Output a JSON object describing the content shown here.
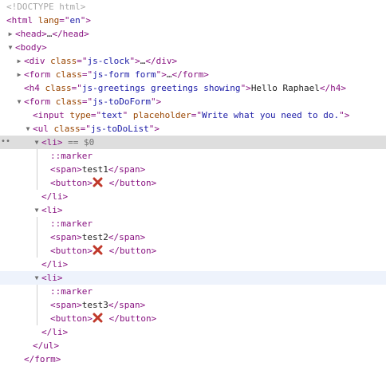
{
  "tree": [
    {
      "indent": 0,
      "toggle": "none",
      "selected": false,
      "hovered": false,
      "parts": [
        {
          "t": "doctype",
          "v": "<!DOCTYPE html>"
        }
      ]
    },
    {
      "indent": 0,
      "toggle": "none",
      "selected": false,
      "hovered": false,
      "parts": [
        {
          "t": "tag",
          "v": "<html "
        },
        {
          "t": "attr",
          "v": "lang"
        },
        {
          "t": "tag",
          "v": "=\""
        },
        {
          "t": "val",
          "v": "en"
        },
        {
          "t": "tag",
          "v": "\">"
        }
      ]
    },
    {
      "indent": 1,
      "toggle": "collapsed",
      "selected": false,
      "hovered": false,
      "parts": [
        {
          "t": "tag",
          "v": "<head>"
        },
        {
          "t": "txt",
          "v": "…"
        },
        {
          "t": "tag",
          "v": "</head>"
        }
      ]
    },
    {
      "indent": 1,
      "toggle": "expanded",
      "selected": false,
      "hovered": false,
      "parts": [
        {
          "t": "tag",
          "v": "<body>"
        }
      ]
    },
    {
      "indent": 2,
      "toggle": "collapsed",
      "selected": false,
      "hovered": false,
      "parts": [
        {
          "t": "tag",
          "v": "<div "
        },
        {
          "t": "attr",
          "v": "class"
        },
        {
          "t": "tag",
          "v": "=\""
        },
        {
          "t": "val",
          "v": "js-clock"
        },
        {
          "t": "tag",
          "v": "\">"
        },
        {
          "t": "txt",
          "v": "…"
        },
        {
          "t": "tag",
          "v": "</div>"
        }
      ]
    },
    {
      "indent": 2,
      "toggle": "collapsed",
      "selected": false,
      "hovered": false,
      "parts": [
        {
          "t": "tag",
          "v": "<form "
        },
        {
          "t": "attr",
          "v": "class"
        },
        {
          "t": "tag",
          "v": "=\""
        },
        {
          "t": "val",
          "v": "js-form form"
        },
        {
          "t": "tag",
          "v": "\">"
        },
        {
          "t": "txt",
          "v": "…"
        },
        {
          "t": "tag",
          "v": "</form>"
        }
      ]
    },
    {
      "indent": 2,
      "toggle": "none",
      "selected": false,
      "hovered": false,
      "parts": [
        {
          "t": "tag",
          "v": "<h4 "
        },
        {
          "t": "attr",
          "v": "class"
        },
        {
          "t": "tag",
          "v": "=\""
        },
        {
          "t": "val",
          "v": "js-greetings greetings showing"
        },
        {
          "t": "tag",
          "v": "\">"
        },
        {
          "t": "txt",
          "v": "Hello Raphael"
        },
        {
          "t": "tag",
          "v": "</h4>"
        }
      ]
    },
    {
      "indent": 2,
      "toggle": "expanded",
      "selected": false,
      "hovered": false,
      "parts": [
        {
          "t": "tag",
          "v": "<form "
        },
        {
          "t": "attr",
          "v": "class"
        },
        {
          "t": "tag",
          "v": "=\""
        },
        {
          "t": "val",
          "v": "js-toDoForm"
        },
        {
          "t": "tag",
          "v": "\">"
        }
      ]
    },
    {
      "indent": 3,
      "toggle": "none",
      "selected": false,
      "hovered": false,
      "parts": [
        {
          "t": "tag",
          "v": "<input "
        },
        {
          "t": "attr",
          "v": "type"
        },
        {
          "t": "tag",
          "v": "=\""
        },
        {
          "t": "val",
          "v": "text"
        },
        {
          "t": "tag",
          "v": "\" "
        },
        {
          "t": "attr",
          "v": "placeholder"
        },
        {
          "t": "tag",
          "v": "=\""
        },
        {
          "t": "val",
          "v": "Write what you need to do."
        },
        {
          "t": "tag",
          "v": "\">"
        }
      ]
    },
    {
      "indent": 3,
      "toggle": "expanded",
      "selected": false,
      "hovered": false,
      "parts": [
        {
          "t": "tag",
          "v": "<ul "
        },
        {
          "t": "attr",
          "v": "class"
        },
        {
          "t": "tag",
          "v": "=\""
        },
        {
          "t": "val",
          "v": "js-toDoList"
        },
        {
          "t": "tag",
          "v": "\">"
        }
      ]
    },
    {
      "indent": 4,
      "toggle": "expanded",
      "selected": true,
      "hovered": false,
      "dots": "••",
      "parts": [
        {
          "t": "tag",
          "v": "<li>"
        },
        {
          "t": "eq",
          "v": " == $0"
        }
      ]
    },
    {
      "indent": 5,
      "toggle": "none",
      "selected": false,
      "hovered": false,
      "guide": true,
      "parts": [
        {
          "t": "pseudo",
          "v": "::marker"
        }
      ]
    },
    {
      "indent": 5,
      "toggle": "none",
      "selected": false,
      "hovered": false,
      "guide": true,
      "parts": [
        {
          "t": "tag",
          "v": "<span>"
        },
        {
          "t": "txt",
          "v": "test1"
        },
        {
          "t": "tag",
          "v": "</span>"
        }
      ]
    },
    {
      "indent": 5,
      "toggle": "none",
      "selected": false,
      "hovered": false,
      "guide": true,
      "parts": [
        {
          "t": "tag",
          "v": "<button>"
        },
        {
          "t": "icon",
          "v": "cross-mark-icon"
        },
        {
          "t": "txt",
          "v": " "
        },
        {
          "t": "tag",
          "v": "</button>"
        }
      ]
    },
    {
      "indent": 4,
      "toggle": "none",
      "selected": false,
      "hovered": false,
      "parts": [
        {
          "t": "tag",
          "v": "</li>"
        }
      ]
    },
    {
      "indent": 4,
      "toggle": "expanded",
      "selected": false,
      "hovered": false,
      "parts": [
        {
          "t": "tag",
          "v": "<li>"
        }
      ]
    },
    {
      "indent": 5,
      "toggle": "none",
      "selected": false,
      "hovered": false,
      "guide": true,
      "parts": [
        {
          "t": "pseudo",
          "v": "::marker"
        }
      ]
    },
    {
      "indent": 5,
      "toggle": "none",
      "selected": false,
      "hovered": false,
      "guide": true,
      "parts": [
        {
          "t": "tag",
          "v": "<span>"
        },
        {
          "t": "txt",
          "v": "test2"
        },
        {
          "t": "tag",
          "v": "</span>"
        }
      ]
    },
    {
      "indent": 5,
      "toggle": "none",
      "selected": false,
      "hovered": false,
      "guide": true,
      "parts": [
        {
          "t": "tag",
          "v": "<button>"
        },
        {
          "t": "icon",
          "v": "cross-mark-icon"
        },
        {
          "t": "txt",
          "v": " "
        },
        {
          "t": "tag",
          "v": "</button>"
        }
      ]
    },
    {
      "indent": 4,
      "toggle": "none",
      "selected": false,
      "hovered": false,
      "parts": [
        {
          "t": "tag",
          "v": "</li>"
        }
      ]
    },
    {
      "indent": 4,
      "toggle": "expanded",
      "selected": false,
      "hovered": true,
      "parts": [
        {
          "t": "tag",
          "v": "<li>"
        }
      ]
    },
    {
      "indent": 5,
      "toggle": "none",
      "selected": false,
      "hovered": false,
      "guide": true,
      "parts": [
        {
          "t": "pseudo",
          "v": "::marker"
        }
      ]
    },
    {
      "indent": 5,
      "toggle": "none",
      "selected": false,
      "hovered": false,
      "guide": true,
      "parts": [
        {
          "t": "tag",
          "v": "<span>"
        },
        {
          "t": "txt",
          "v": "test3"
        },
        {
          "t": "tag",
          "v": "</span>"
        }
      ]
    },
    {
      "indent": 5,
      "toggle": "none",
      "selected": false,
      "hovered": false,
      "guide": true,
      "parts": [
        {
          "t": "tag",
          "v": "<button>"
        },
        {
          "t": "icon",
          "v": "cross-mark-icon"
        },
        {
          "t": "txt",
          "v": " "
        },
        {
          "t": "tag",
          "v": "</button>"
        }
      ]
    },
    {
      "indent": 4,
      "toggle": "none",
      "selected": false,
      "hovered": false,
      "parts": [
        {
          "t": "tag",
          "v": "</li>"
        }
      ]
    },
    {
      "indent": 3,
      "toggle": "none",
      "selected": false,
      "hovered": false,
      "parts": [
        {
          "t": "tag",
          "v": "</ul>"
        }
      ]
    },
    {
      "indent": 2,
      "toggle": "none",
      "selected": false,
      "hovered": false,
      "parts": [
        {
          "t": "tag",
          "v": "</form>"
        }
      ]
    }
  ],
  "colors": {
    "tag": "#881280",
    "attr": "#994500",
    "value": "#1a1aa6",
    "text": "#222222",
    "selected_row": "#dedede",
    "hovered_row": "#eef3fc",
    "cross_icon": "#c0392b"
  },
  "glyphs": {
    "expanded": "▼",
    "collapsed": "▶"
  }
}
